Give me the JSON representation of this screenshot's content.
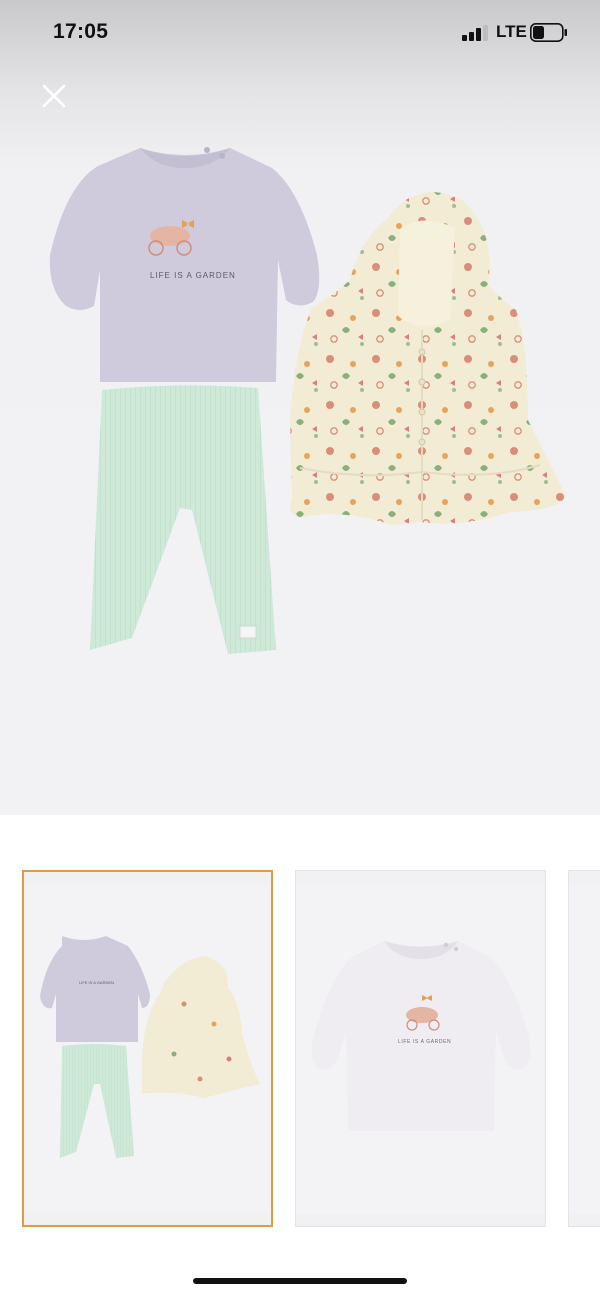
{
  "status_bar": {
    "time": "17:05",
    "network": "LTE",
    "signal_bars": 3,
    "battery_level": 0.35
  },
  "viewer": {
    "close_icon": "close-icon",
    "main_image": {
      "top_print_text": "LIFE IS A GARDEN",
      "colors": {
        "top": "#cfcbdc",
        "leggings": "#cfe9d9",
        "jacket": "#f1ecd3"
      }
    },
    "thumbnails": [
      {
        "selected": true,
        "subject": "full-set",
        "print_text": "LIFE IS A GARDEN"
      },
      {
        "selected": false,
        "subject": "top-only",
        "print_text": "LIFE IS A GARDEN"
      },
      {
        "selected": false,
        "subject": "partial"
      }
    ],
    "accent_color": "#e09a3f"
  }
}
